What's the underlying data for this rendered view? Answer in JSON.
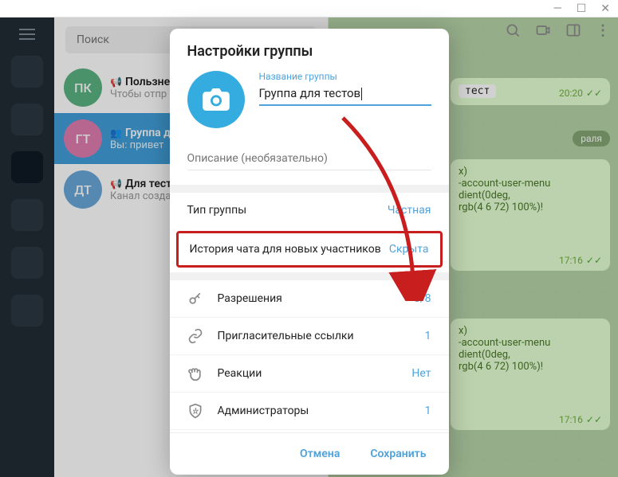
{
  "search": {
    "placeholder": "Поиск"
  },
  "chats": [
    {
      "avatar": "ПК",
      "title": "Пользне",
      "sub": "Чтобы отпр",
      "icon": "megaphone"
    },
    {
      "avatar": "ГТ",
      "title": "Группа д",
      "sub": "Вы: привет",
      "icon": "people"
    },
    {
      "avatar": "ДТ",
      "title": "Для тест",
      "sub": "Канал созда",
      "icon": "megaphone"
    }
  ],
  "date_pill": "раля",
  "bubbles": {
    "b1": {
      "label": "тест",
      "time": "20:20"
    },
    "b2": {
      "line1": "x)",
      "line2": "-account-user-menu",
      "line3": "dient(0deg,",
      "line4": "rgb(4 6 72) 100%)!",
      "time": "17:16"
    },
    "b3": {
      "line1": "x)",
      "line2": "-account-user-menu",
      "line3": "dient(0deg,",
      "line4": "rgb(4 6 72) 100%)!",
      "time": "17:16"
    }
  },
  "dialog": {
    "title": "Настройки группы",
    "name_label": "Название группы",
    "name_value": "Группа для тестов",
    "desc_placeholder": "Описание (необязательно)",
    "type_label": "Тип группы",
    "type_value": "Частная",
    "history_label": "История чата для новых участников",
    "history_value": "Скрыта",
    "perms_label": "Разрешения",
    "perms_value": "8/8",
    "links_label": "Пригласительные ссылки",
    "links_value": "1",
    "reactions_label": "Реакции",
    "reactions_value": "Нет",
    "admins_label": "Администраторы",
    "admins_value": "1",
    "cancel": "Отмена",
    "save": "Сохранить"
  }
}
